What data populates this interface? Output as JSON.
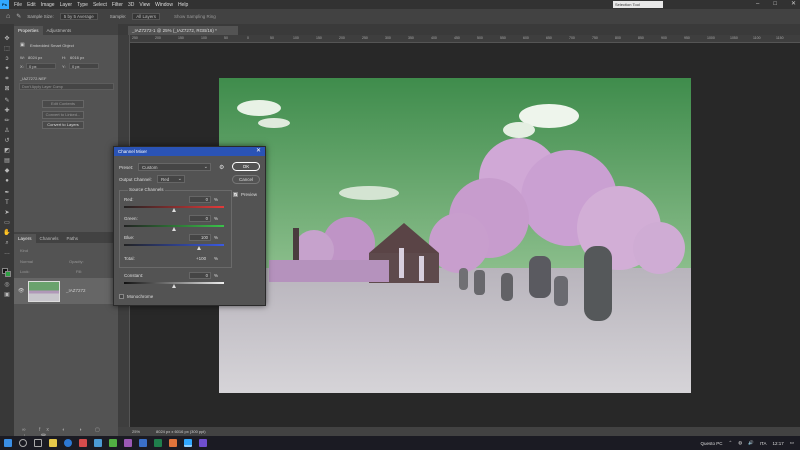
{
  "menubar": {
    "logo": "Ps",
    "items": [
      "File",
      "Edit",
      "Image",
      "Layer",
      "Type",
      "Select",
      "Filter",
      "3D",
      "View",
      "Window",
      "Help"
    ],
    "selection_tip": "Selection Tool"
  },
  "options": {
    "sample_size_label": "Sample Size:",
    "sample_size_value": "5 by 5 Average",
    "sample_label": "Sample:",
    "sample_value": "All Layers",
    "show_ring": "Show Sampling Ring"
  },
  "properties": {
    "tabs": [
      "Properties",
      "Adjustments"
    ],
    "object_type": "Embedded Smart Object",
    "w_label": "W:",
    "w_value": "8024 px",
    "h_label": "H:",
    "h_value": "6016 px",
    "x_label": "X:",
    "x_value": "0 px",
    "y_label": "Y:",
    "y_value": "0 px",
    "file_name": "_IAZ7272.NEF",
    "comp_placeholder": "Don't Apply Layer Comp",
    "btn_edit": "Edit Contents",
    "btn_convert_linked": "Convert to Linked...",
    "btn_convert_layers": "Convert to Layers"
  },
  "layers": {
    "tabs": [
      "Layers",
      "Channels",
      "Paths"
    ],
    "kind": "Kind",
    "blend": "Normal",
    "opacity_label": "Opacity:",
    "lock_label": "Lock:",
    "fill_label": "Fill:",
    "layer_name": "_IAZ7272"
  },
  "document": {
    "tab_title": "_IAZ7272-1 @ 25% (_IAZ7272, RGB/16) *",
    "ruler_ticks": [
      "250",
      "200",
      "150",
      "100",
      "50",
      "0",
      "50",
      "100",
      "150",
      "200",
      "250",
      "300",
      "350",
      "400",
      "450",
      "500",
      "550",
      "600",
      "650",
      "700",
      "750",
      "800",
      "850",
      "900",
      "950",
      "1000",
      "1050",
      "1100",
      "1150"
    ]
  },
  "status": {
    "zoom": "25%",
    "doc_info": "8024 px x 6016 px (300 ppi)"
  },
  "dialog": {
    "title": "Channel Mixer",
    "preset_label": "Preset:",
    "preset_value": "Custom",
    "output_label": "Output Channel:",
    "output_value": "Red",
    "source_label": "Source Channels",
    "red_label": "Red:",
    "red_value": "0",
    "green_label": "Green:",
    "green_value": "0",
    "blue_label": "Blue:",
    "blue_value": "100",
    "total_label": "Total:",
    "total_value": "+100",
    "constant_label": "Constant:",
    "constant_value": "0",
    "pct": "%",
    "monochrome": "Monochrome",
    "ok": "OK",
    "cancel": "Cancel",
    "preview": "Preview",
    "red_pct": 0,
    "green_pct": 0,
    "blue_pct": 100,
    "constant_pct": 0
  },
  "taskbar": {
    "pc": "Questo PC",
    "lang": "ITA",
    "time": "12:17"
  },
  "colors": {
    "accent": "#2a53b5",
    "ok_ring": "#ffffff",
    "sky": "#5a9a60",
    "trees": "#c9a4cf",
    "grass": "#c4c2c6"
  }
}
